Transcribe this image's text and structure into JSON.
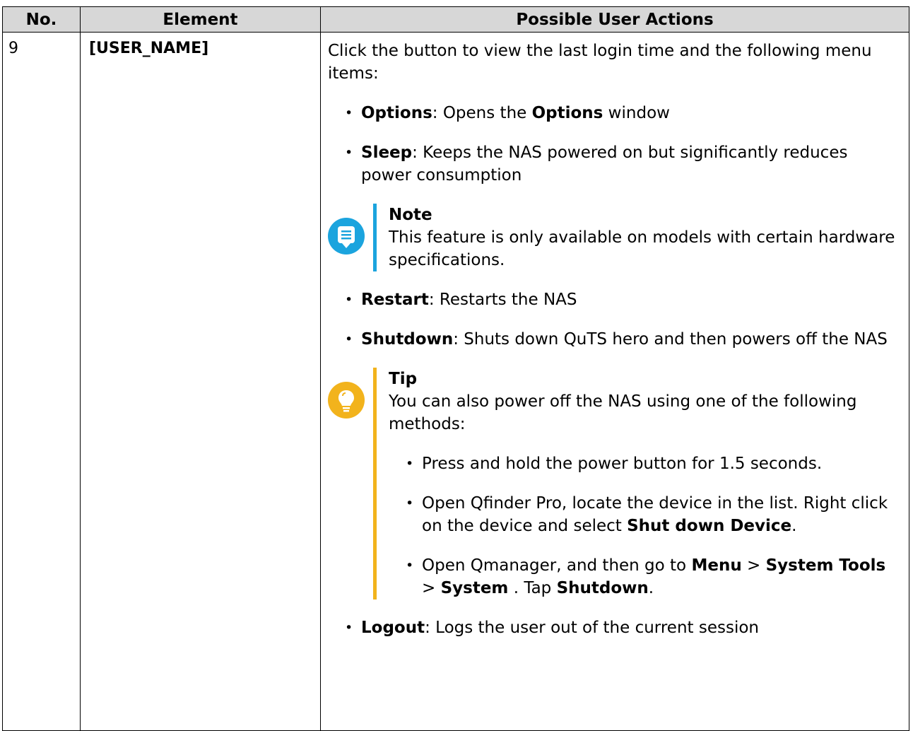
{
  "table": {
    "headers": [
      "No.",
      "Element",
      "Possible User Actions"
    ],
    "row": {
      "no": "9",
      "element": "[USER_NAME]",
      "intro": "Click the button to view the last login time and the following menu items:",
      "items": [
        {
          "term": "Options",
          "text_a": ": Opens the ",
          "term_b": "Options",
          "text_b": " window"
        },
        {
          "term": "Sleep",
          "text_a": ": Keeps the NAS powered on but significantly reduces power consumption"
        },
        {
          "term": "Restart",
          "text_a": ": Restarts the NAS"
        },
        {
          "term": "Shutdown",
          "text_a": ": Shuts down QuTS hero and then powers off the NAS"
        },
        {
          "term": "Logout",
          "text_a": ": Logs the user out of the current session"
        }
      ],
      "note": {
        "title": "Note",
        "text": "This feature is only available on models with certain hardware specifications.",
        "icon": "note-icon",
        "color": "#1ba4de"
      },
      "tip": {
        "title": "Tip",
        "text": "You can also power off the NAS using one of the following methods:",
        "icon": "lightbulb-icon",
        "color": "#f2b31c",
        "methods": [
          {
            "text": "Press and hold the power button for 1.5 seconds."
          },
          {
            "text": "Open Qfinder Pro, locate the device in the list. Right click on the device and select ",
            "bold": "Shut down Device",
            "end": "."
          },
          {
            "p1": "Open Qmanager, and then go to ",
            "b1": "Menu",
            "p2": " > ",
            "b2": "System Tools",
            "p3": " > ",
            "b3": "System",
            "p4": " . Tap ",
            "b4": "Shutdown",
            "p5": "."
          }
        ]
      }
    }
  }
}
